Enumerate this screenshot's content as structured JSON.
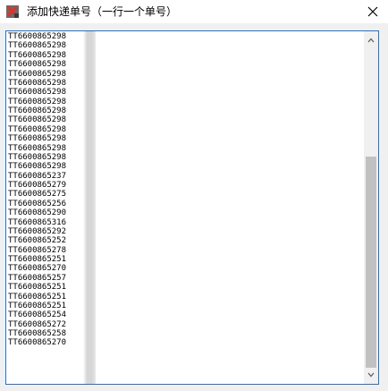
{
  "window": {
    "title": "添加快递单号（一行一个单号）",
    "close_glyph": "✕",
    "app_icon": "app-icon-red-cross"
  },
  "textarea": {
    "lines": [
      "TT6600865298",
      "TT6600865298",
      "TT6600865298",
      "TT6600865298",
      "TT6600865298",
      "TT6600865298",
      "TT6600865298",
      "TT6600865298",
      "TT6600865298",
      "TT6600865298",
      "TT6600865298",
      "TT6600865298",
      "TT6600865298",
      "TT6600865298",
      "TT6600865298",
      "TT6600865237",
      "TT6600865279",
      "TT6600865275",
      "TT6600865256",
      "TT6600865290",
      "TT6600865316",
      "TT6600865292",
      "TT6600865252",
      "TT6600865278",
      "TT6600865251",
      "TT6600865270",
      "TT6600865257",
      "TT6600865251",
      "TT6600865251",
      "TT6600865251",
      "TT6600865254",
      "TT6600865272",
      "TT6600865258",
      "TT6600865270"
    ],
    "scroll_position": 0.36,
    "accent_border": "#1e74d6"
  },
  "scrollbar": {
    "up_icon": "chevron-up-icon",
    "down_icon": "chevron-down-icon"
  }
}
